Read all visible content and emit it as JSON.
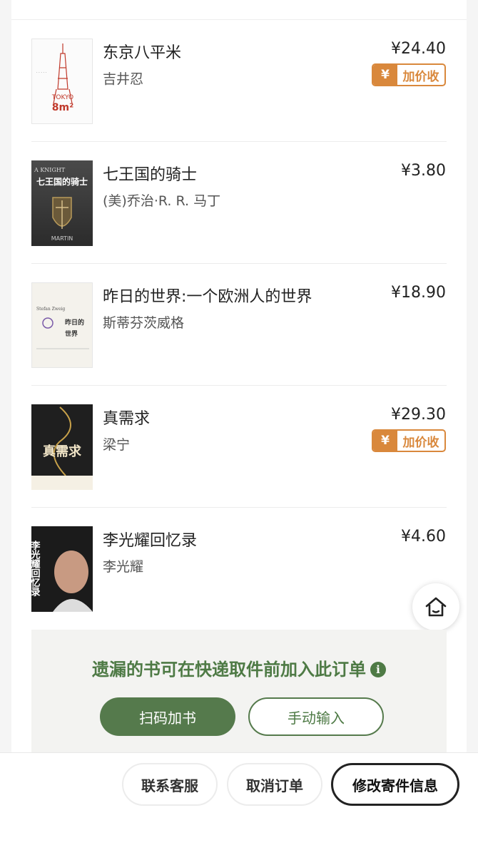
{
  "books": [
    {
      "title": "东京八平米",
      "author": "吉井忍",
      "price": "¥24.40",
      "badge": "加价收",
      "cover_text": [
        "TOKYO",
        "8m²"
      ]
    },
    {
      "title": "七王国的骑士",
      "author": "(美)乔治·R. R. 马丁",
      "price": "¥3.80",
      "badge": null,
      "cover_text": [
        "七王国的骑士",
        "MARTIN"
      ]
    },
    {
      "title": "昨日的世界:一个欧洲人的世界",
      "author": "斯蒂芬茨威格",
      "price": "¥18.90",
      "badge": null,
      "cover_text": [
        "Stefan Zweig",
        "昨日的",
        "世界"
      ]
    },
    {
      "title": "真需求",
      "author": "梁宁",
      "price": "¥29.30",
      "badge": "加价收",
      "cover_text": [
        "真需求"
      ]
    },
    {
      "title": "李光耀回忆录",
      "author": "李光耀",
      "price": "¥4.60",
      "badge": null,
      "cover_text": [
        "李光耀回忆录"
      ]
    }
  ],
  "missing_panel": {
    "text": "遗漏的书可在快递取件前加入此订单",
    "info_icon": "i",
    "scan_label": "扫码加书",
    "manual_label": "手动输入"
  },
  "bottom_bar": {
    "contact_label": "联系客服",
    "cancel_label": "取消订单",
    "modify_label": "修改寄件信息"
  },
  "badge_symbol": "¥",
  "colors": {
    "accent_green": "#557a4c",
    "badge_orange": "#d9883c"
  }
}
